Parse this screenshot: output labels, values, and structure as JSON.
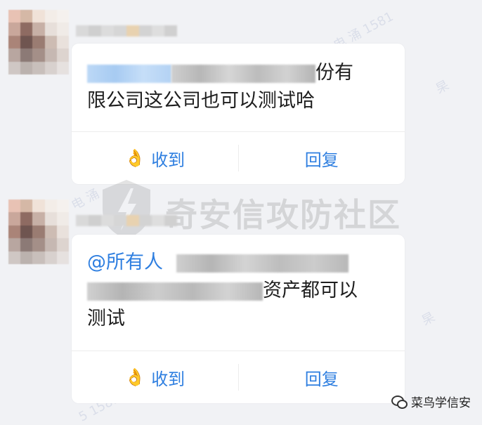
{
  "messages": [
    {
      "line1_visible_suffix": "份有",
      "line2": "限公司这公司也可以测试哈",
      "actions": {
        "received": "收到",
        "reply": "回复"
      }
    },
    {
      "mention": "@所有人",
      "line2_visible_suffix": "资产都可以",
      "line3": "测试",
      "actions": {
        "received": "收到",
        "reply": "回复"
      }
    }
  ],
  "watermark": {
    "text": "奇安信攻防社区"
  },
  "footer": {
    "label": "菜鸟学信安"
  },
  "colors": {
    "accent": "#2f7fe0",
    "background": "#f1f2f5",
    "card": "#ffffff"
  }
}
